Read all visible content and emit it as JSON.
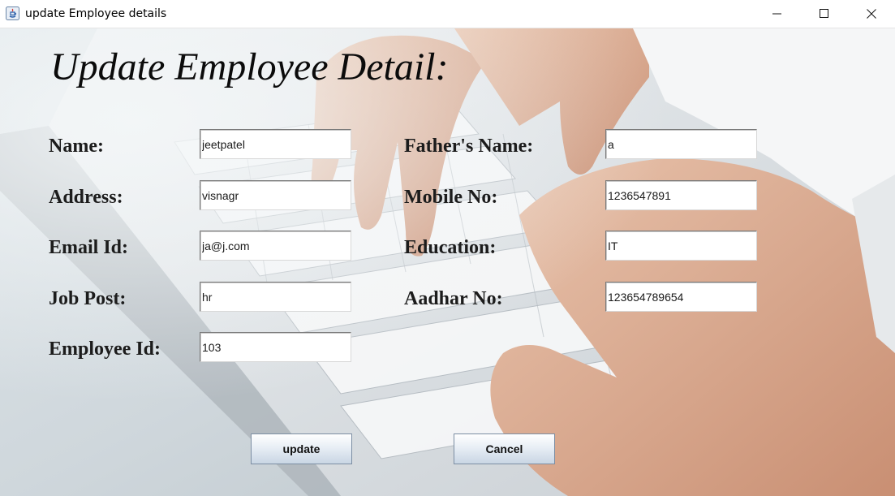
{
  "window": {
    "title": "update Employee details",
    "icon": "java-icon"
  },
  "form": {
    "heading": "Update Employee Detail:",
    "fields": {
      "name": {
        "label": "Name:",
        "value": "jeetpatel"
      },
      "father_name": {
        "label": "Father's Name:",
        "value": "a"
      },
      "address": {
        "label": "Address:",
        "value": "visnagr"
      },
      "mobile": {
        "label": "Mobile No:",
        "value": "1236547891"
      },
      "email": {
        "label": "Email Id:",
        "value": "ja@j.com"
      },
      "education": {
        "label": "Education:",
        "value": "IT"
      },
      "job_post": {
        "label": "Job Post:",
        "value": "hr"
      },
      "aadhar": {
        "label": "Aadhar No:",
        "value": "123654789654"
      },
      "employee_id": {
        "label": "Employee Id:",
        "value": "103"
      }
    },
    "buttons": {
      "update": "update",
      "cancel": "Cancel"
    }
  },
  "colors": {
    "button_gradient_bottom": "#c9d6e4",
    "label_text": "#1c1c1c"
  }
}
